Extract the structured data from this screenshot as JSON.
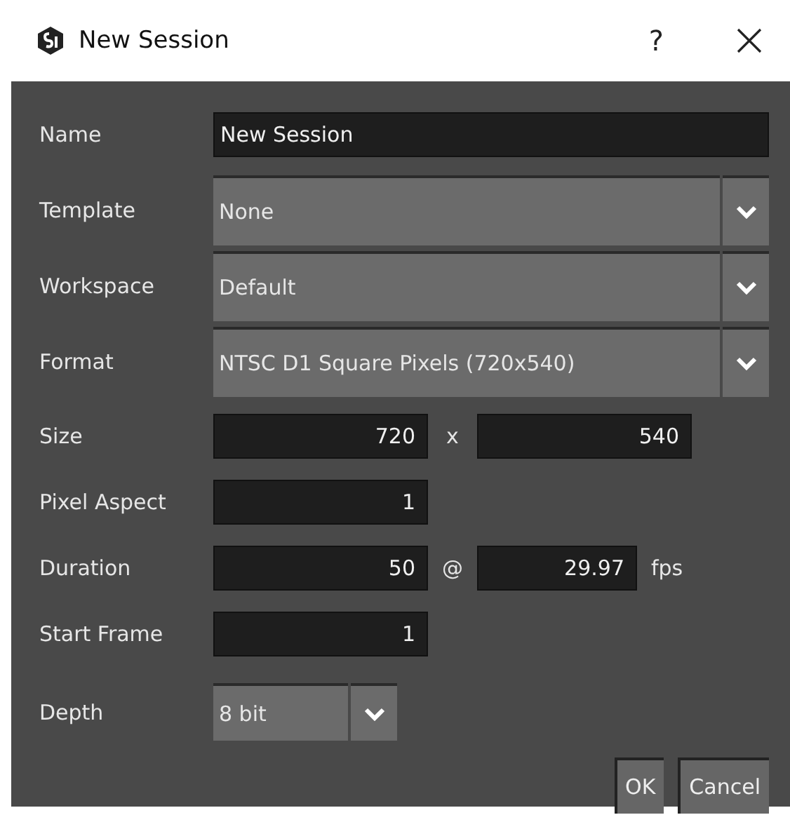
{
  "window": {
    "title": "New Session",
    "help": "?"
  },
  "fields": [
    {
      "kind": "text",
      "label": "Name",
      "value": "New Session"
    },
    {
      "kind": "combo",
      "label": "Template",
      "value": "None"
    },
    {
      "kind": "combo",
      "label": "Workspace",
      "value": "Default"
    },
    {
      "kind": "combo",
      "label": "Format",
      "value": "NTSC D1 Square Pixels (720x540)"
    },
    {
      "kind": "pair",
      "label": "Size",
      "value": "720",
      "separator": "x",
      "value2": "540"
    },
    {
      "kind": "number",
      "label": "Pixel Aspect",
      "value": "1"
    },
    {
      "kind": "pair",
      "label": "Duration",
      "value": "50",
      "separator": "@",
      "value2": "29.97",
      "unit": "fps"
    },
    {
      "kind": "number",
      "label": "Start Frame",
      "value": "1"
    },
    {
      "kind": "small-combo",
      "label": "Depth",
      "value": "8 bit"
    }
  ],
  "buttons": [
    "OK",
    "Cancel"
  ]
}
